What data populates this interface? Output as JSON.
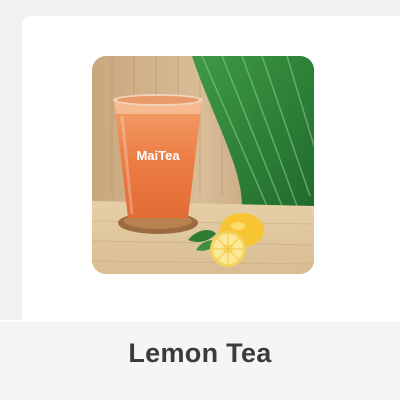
{
  "product": {
    "name": "Lemon Tea",
    "image_alt": "Lemon Tea",
    "cup_brand": "MaiTea"
  },
  "colors": {
    "title_text": "#3b3b3b",
    "caption_background": "#f5f4f7",
    "tea": "#e9783f",
    "lemon": "#f7c531"
  }
}
